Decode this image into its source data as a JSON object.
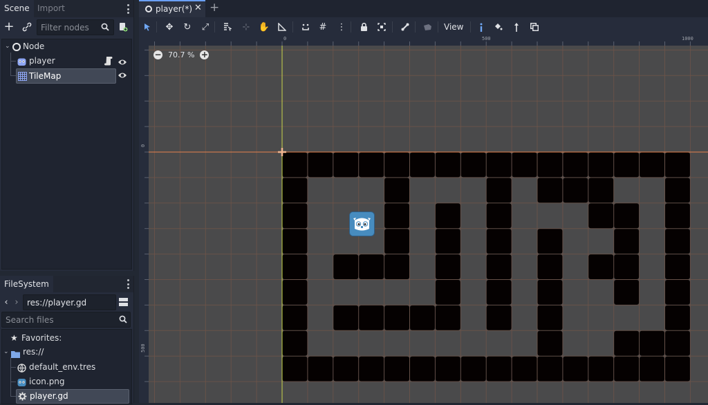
{
  "scene_dock": {
    "tabs": [
      {
        "label": "Scene",
        "active": true
      },
      {
        "label": "Import",
        "active": false
      }
    ],
    "filter_placeholder": "Filter nodes",
    "tree": [
      {
        "label": "Node",
        "icon": "circle-node-icon"
      },
      {
        "label": "player",
        "icon": "godot-sprite-icon",
        "has_script": true,
        "visible": true
      },
      {
        "label": "TileMap",
        "icon": "tilemap-grid-icon",
        "visible": true,
        "selected": true
      }
    ]
  },
  "filesystem_dock": {
    "tab_label": "FileSystem",
    "path_value": "res://player.gd",
    "search_placeholder": "Search files",
    "favorites_label": "Favorites:",
    "root_label": "res://",
    "files": [
      {
        "label": "default_env.tres",
        "icon": "globe-resource-icon"
      },
      {
        "label": "icon.png",
        "icon": "image-file-icon"
      },
      {
        "label": "player.gd",
        "icon": "gear-script-icon",
        "selected": true
      }
    ]
  },
  "editor_tabs": [
    {
      "label": "player(*)",
      "active": true
    }
  ],
  "toolbar": {
    "view_label": "View"
  },
  "viewport": {
    "zoom_label": "70.7 %",
    "ruler_top_labels": [
      "0",
      "500",
      "1000"
    ],
    "ruler_left_labels": [
      "0",
      "500"
    ],
    "tilemap_rows": [
      "1111111111111111",
      "1000100010111001",
      "1000101010001101",
      "1000101010100101",
      "1011101010101101",
      "1000001010100101",
      "1011111010100001",
      "1000000000100111",
      "1111111111111111"
    ],
    "colors": {
      "tile": "#050101",
      "grid": "#6f5449",
      "axis_x": "#e8834e",
      "axis_y": "#c9d64b",
      "background": "#4a4a4b"
    }
  }
}
